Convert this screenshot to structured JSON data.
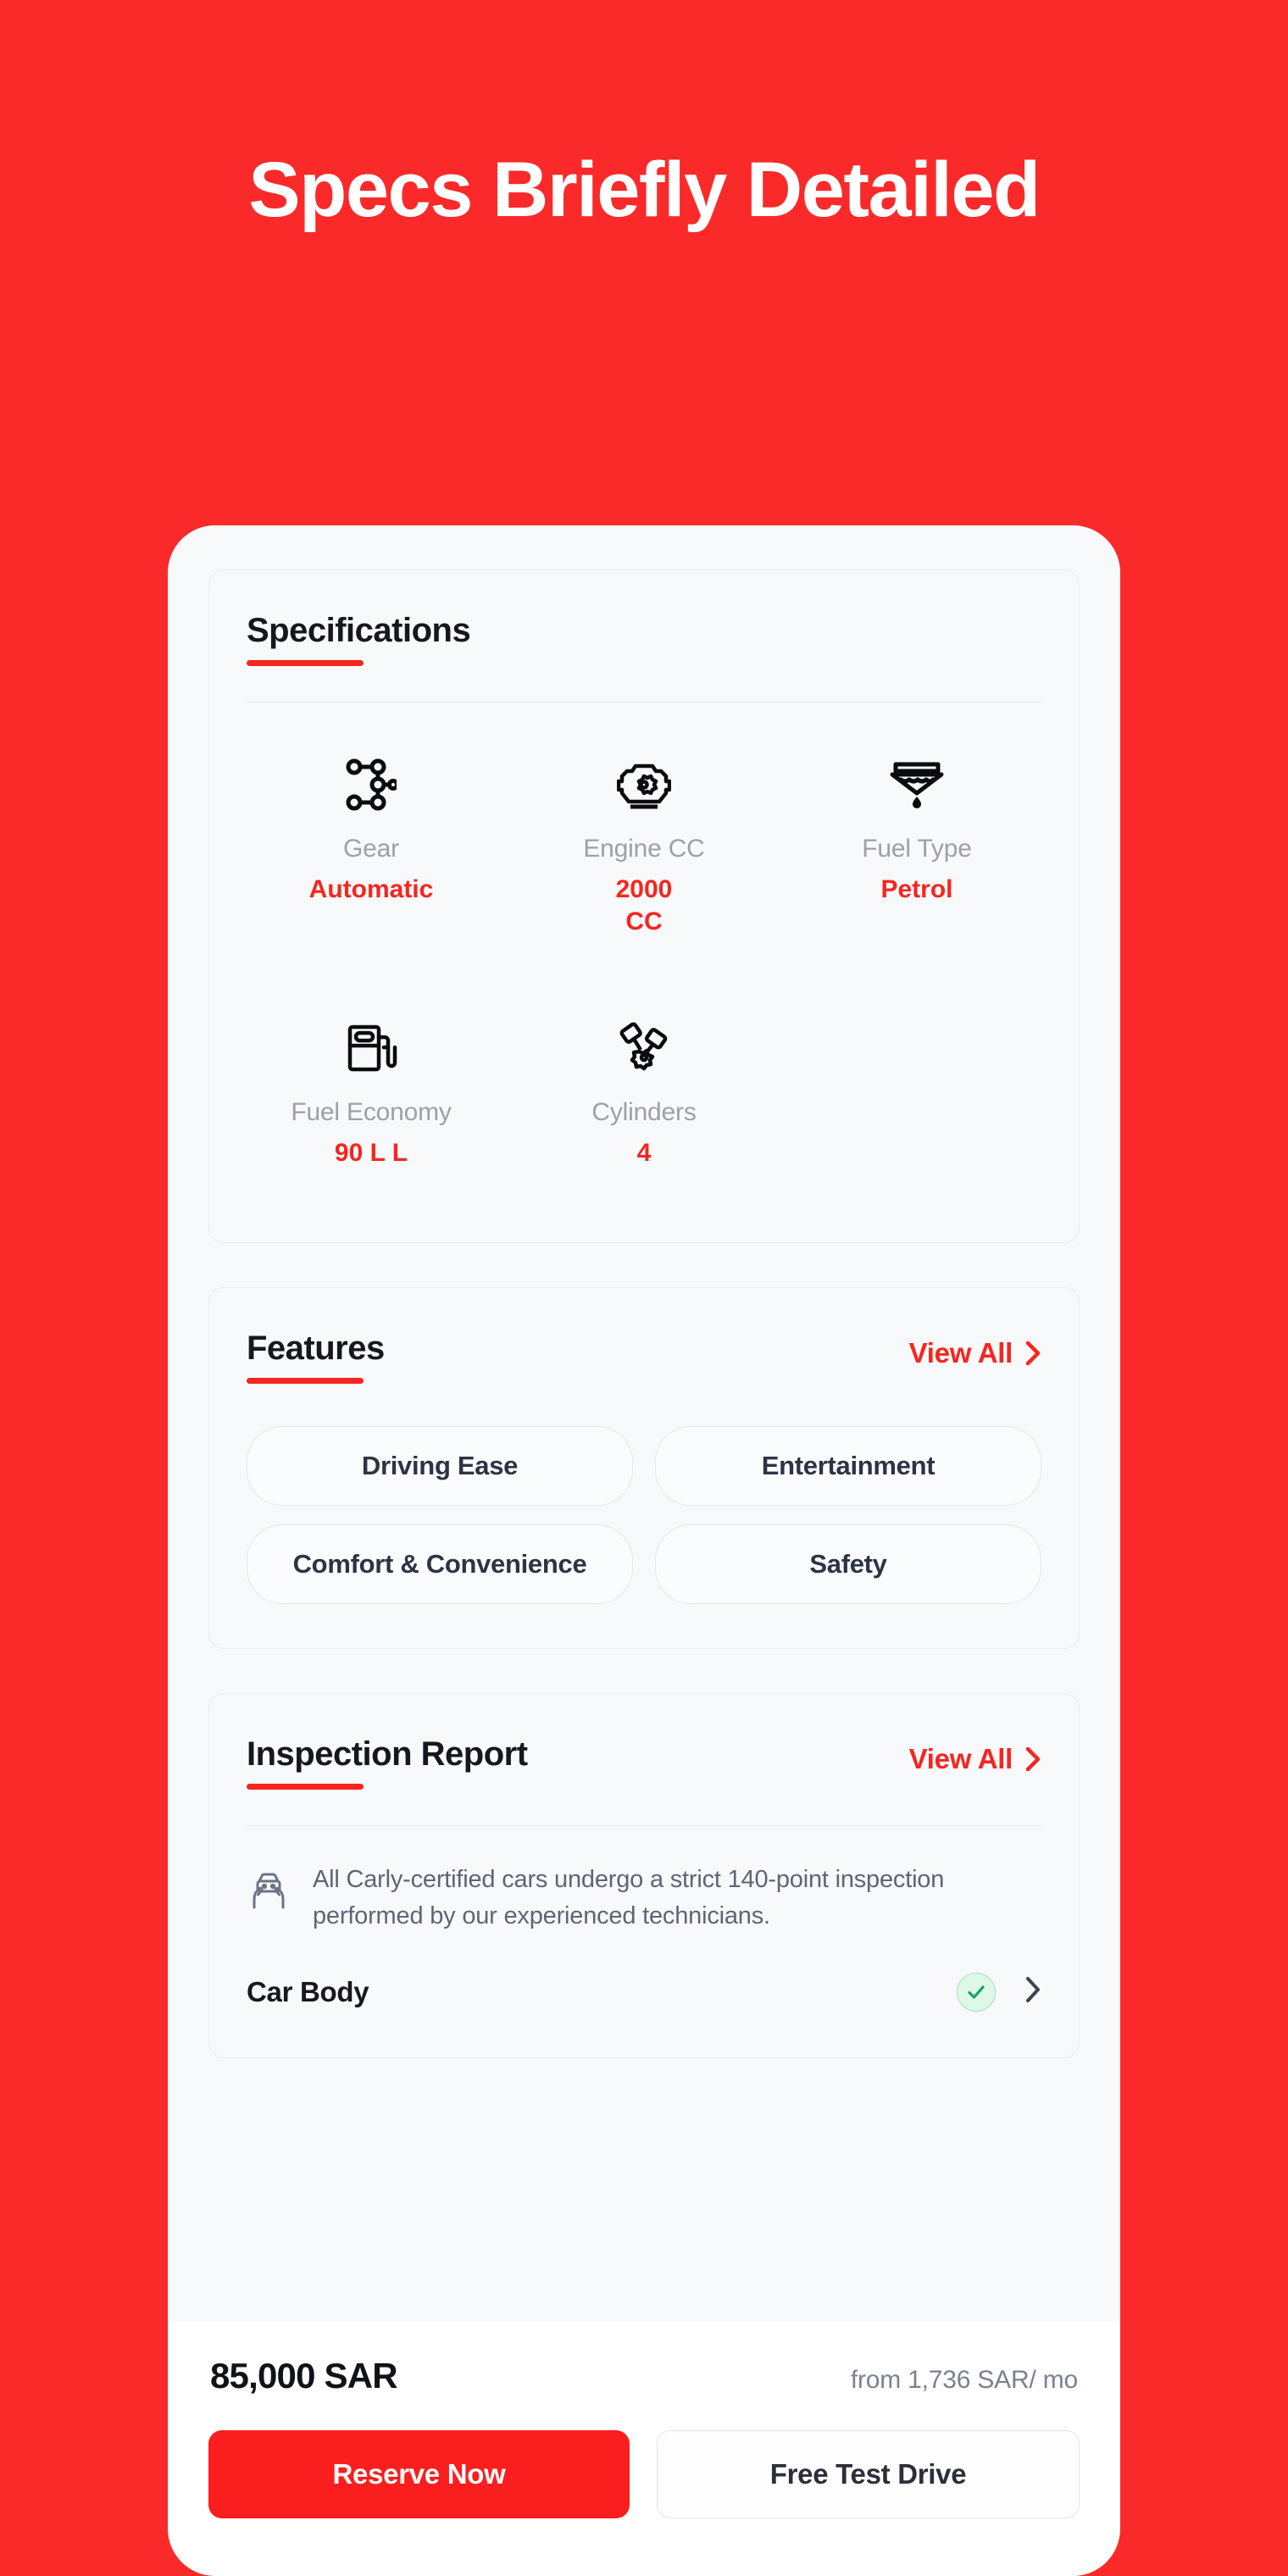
{
  "hero": {
    "title": "Specs Briefly Detailed"
  },
  "theme": {
    "background_red": "#FA2A2A",
    "accent_red": "#F5261F",
    "button_red": "#FA1E1E",
    "card_bg": "#F8F9FB",
    "label_gray": "#9CA0A8",
    "text_dark": "#16181F",
    "chip_text": "#2C3444",
    "note_text": "#5D6576",
    "check_green": "#19A463"
  },
  "specifications": {
    "title": "Specifications",
    "items": [
      {
        "icon": "gear-shift-icon",
        "label": "Gear",
        "value": "Automatic"
      },
      {
        "icon": "engine-icon",
        "label": "Engine CC",
        "value": "2000 CC"
      },
      {
        "icon": "fuel-funnel-icon",
        "label": "Fuel Type",
        "value": "Petrol"
      },
      {
        "icon": "fuel-pump-icon",
        "label": "Fuel Economy",
        "value": "90 L L"
      },
      {
        "icon": "pistons-icon",
        "label": "Cylinders",
        "value": "4"
      }
    ]
  },
  "features": {
    "title": "Features",
    "view_all_label": "View All",
    "chips": [
      "Driving Ease",
      "Entertainment",
      "Comfort & Convenience",
      "Safety"
    ]
  },
  "inspection": {
    "title": "Inspection Report",
    "view_all_label": "View All",
    "note_icon": "car-in-hands-icon",
    "note": "All Carly-certified cars undergo a strict 140-point inspection performed by our experienced technicians.",
    "rows": [
      {
        "label": "Car Body",
        "status": "passed"
      }
    ]
  },
  "bottom_bar": {
    "price": "85,000 SAR",
    "installment": "from 1,736 SAR/ mo",
    "primary_button": "Reserve Now",
    "secondary_button": "Free Test Drive"
  }
}
